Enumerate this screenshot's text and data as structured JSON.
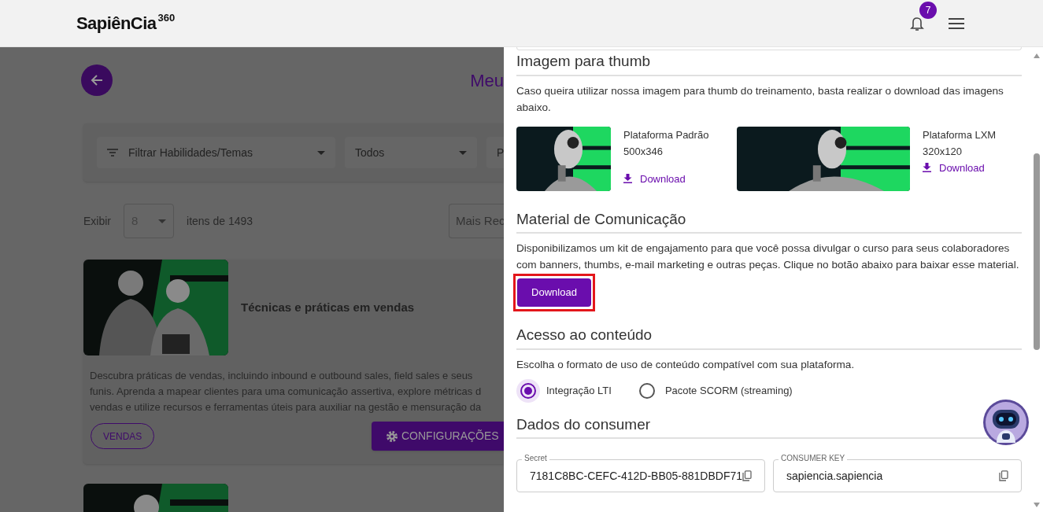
{
  "header": {
    "logo": "SapiênCia",
    "logo_suffix": "360",
    "notification_count": "7"
  },
  "page": {
    "title": "Meu",
    "filters": [
      "Filtrar Habilidades/Temas",
      "Todos",
      "P"
    ],
    "show_label": "Exibir",
    "per_page": "8",
    "count": "itens de 1493",
    "sort": "Mais Rec",
    "course": {
      "title": "Técnicas e práticas em vendas",
      "description_lines": [
        "Descubra práticas de vendas, incluindo inbound e outbound sales, field sales e seus",
        "funis. Aprenda a mapear clientes para uma comunicação assertiva, explore métricas d",
        "vendas e utilize recursos e ferramentas úteis para auxiliar na gestão e mensuração da"
      ],
      "tag": "VENDAS",
      "button": "CONFIGURAÇÕES"
    }
  },
  "drawer": {
    "thumb_section": {
      "heading": "Imagem para thumb",
      "text": "Caso queira utilizar nossa imagem para thumb do treinamento, basta realizar o download das imagens abaixo.",
      "images": [
        {
          "name": "Plataforma Padrão",
          "size": "500x346",
          "link": "Download"
        },
        {
          "name": "Plataforma LXM",
          "size": "320x120",
          "link": "Download"
        }
      ]
    },
    "material_section": {
      "heading": "Material de Comunicação",
      "text": "Disponibilizamos um kit de engajamento para que você possa divulgar o curso para seus colaboradores com banners, thumbs, e-mail marketing e outras peças. Clique no botão abaixo para baixar esse material.",
      "button": "Download",
      "highlighted": true
    },
    "access_section": {
      "heading": "Acesso ao conteúdo",
      "text": "Escolha o formato de uso de conteúdo compatível com sua plataforma.",
      "options": [
        {
          "label": "Integração LTI",
          "selected": true
        },
        {
          "label": "Pacote SCORM (streaming)",
          "selected": false
        }
      ]
    },
    "consumer_section": {
      "heading": "Dados do consumer",
      "fields": [
        {
          "label": "Secret",
          "value": "7181C8BC-CEFC-412D-BB05-881DBDF71"
        },
        {
          "label": "CONSUMER KEY",
          "value": "sapiencia.sapiencia"
        }
      ]
    }
  }
}
